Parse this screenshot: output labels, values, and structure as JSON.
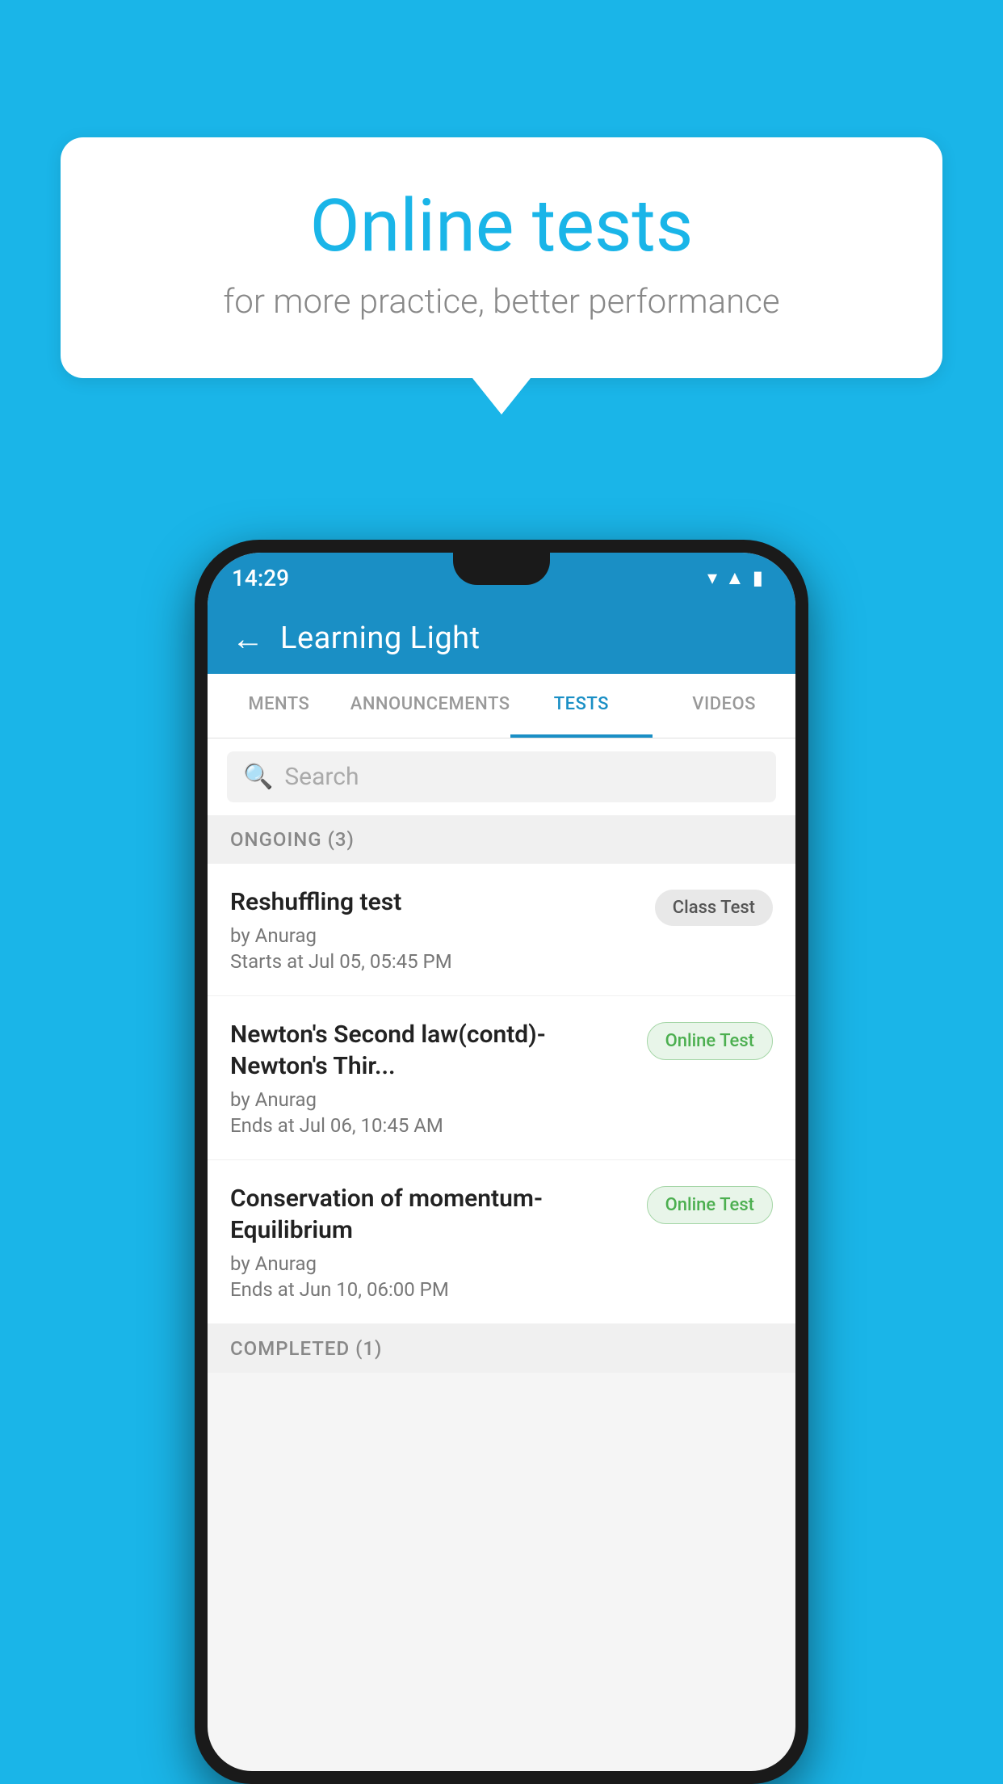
{
  "background_color": "#1ab5e8",
  "bubble": {
    "title": "Online tests",
    "subtitle": "for more practice, better performance"
  },
  "phone": {
    "status_bar": {
      "time": "14:29",
      "icons": [
        "wifi",
        "signal",
        "battery"
      ]
    },
    "header": {
      "back_label": "←",
      "title": "Learning Light"
    },
    "tabs": [
      {
        "label": "MENTS",
        "active": false
      },
      {
        "label": "ANNOUNCEMENTS",
        "active": false
      },
      {
        "label": "TESTS",
        "active": true
      },
      {
        "label": "VIDEOS",
        "active": false
      }
    ],
    "search": {
      "placeholder": "Search"
    },
    "ongoing_section": {
      "label": "ONGOING (3)"
    },
    "tests": [
      {
        "name": "Reshuffling test",
        "by": "by Anurag",
        "time": "Starts at  Jul 05, 05:45 PM",
        "badge": "Class Test",
        "badge_type": "class"
      },
      {
        "name": "Newton's Second law(contd)-Newton's Thir...",
        "by": "by Anurag",
        "time": "Ends at  Jul 06, 10:45 AM",
        "badge": "Online Test",
        "badge_type": "online"
      },
      {
        "name": "Conservation of momentum-Equilibrium",
        "by": "by Anurag",
        "time": "Ends at  Jun 10, 06:00 PM",
        "badge": "Online Test",
        "badge_type": "online"
      }
    ],
    "completed_section": {
      "label": "COMPLETED (1)"
    }
  }
}
